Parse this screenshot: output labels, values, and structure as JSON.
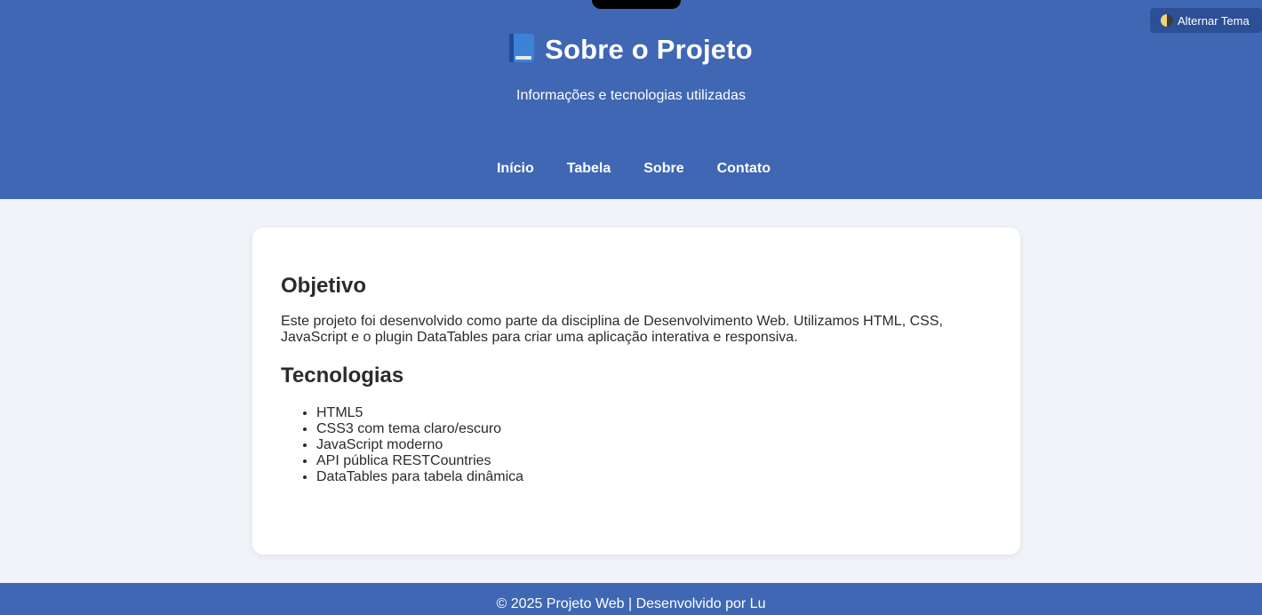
{
  "header": {
    "title": "Sobre o Projeto",
    "title_icon": "blue-book-icon",
    "subtitle": "Informações e tecnologias utilizadas",
    "theme_toggle": {
      "label": "Alternar Tema",
      "icon": "half-moon-icon"
    },
    "accent_color": "#3f67b3"
  },
  "nav": {
    "items": [
      {
        "label": "Início"
      },
      {
        "label": "Tabela"
      },
      {
        "label": "Sobre"
      },
      {
        "label": "Contato"
      }
    ]
  },
  "main": {
    "objective_heading": "Objetivo",
    "objective_text": "Este projeto foi desenvolvido como parte da disciplina de Desenvolvimento Web. Utilizamos HTML, CSS, JavaScript e o plugin DataTables para criar uma aplicação interativa e responsiva.",
    "tech_heading": "Tecnologias",
    "tech_items": [
      "HTML5",
      "CSS3 com tema claro/escuro",
      "JavaScript moderno",
      "API pública RESTCountries",
      "DataTables para tabela dinâmica"
    ]
  },
  "footer": {
    "text": "© 2025 Projeto Web | Desenvolvido por Lu"
  }
}
